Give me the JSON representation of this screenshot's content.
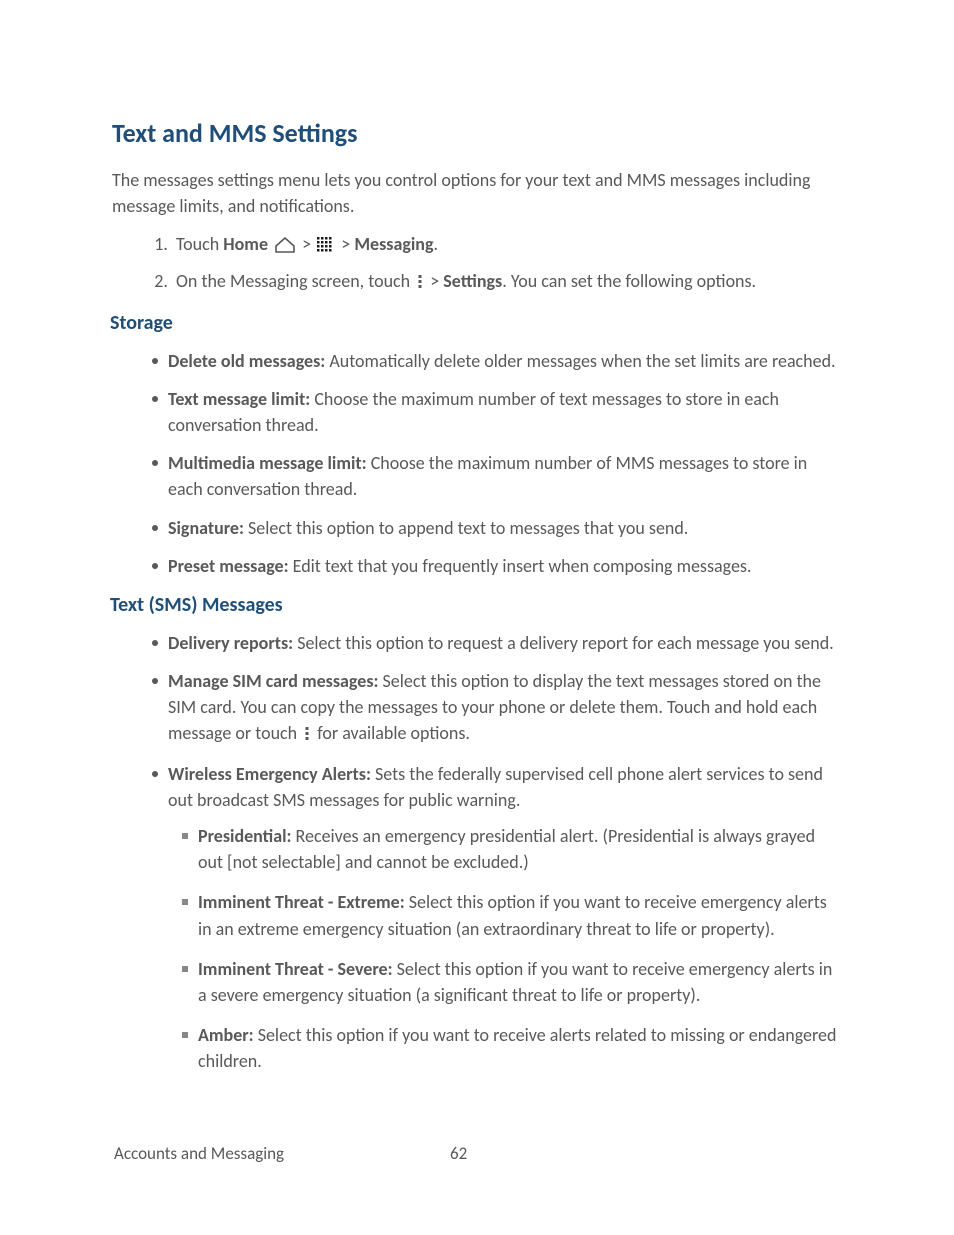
{
  "title": "Text and MMS Settings",
  "intro": "The messages settings menu lets you control options for your text and MMS messages including message limits, and notifications.",
  "steps": {
    "s1_prefix": "Touch ",
    "s1_home": "Home",
    "s1_sep1": " > ",
    "s1_sep2": " > ",
    "s1_messaging": "Messaging",
    "s1_end": ".",
    "s2_prefix": "On the Messaging screen, touch ",
    "s2_sep": " > ",
    "s2_settings": "Settings",
    "s2_end": ". You can set the following options."
  },
  "storage": {
    "heading": "Storage",
    "items": [
      {
        "label": "Delete old messages:",
        "text": " Automatically delete older messages when the set limits are reached."
      },
      {
        "label": "Text message limit:",
        "text": " Choose the maximum number of text messages to store in each conversation thread."
      },
      {
        "label": "Multimedia message limit:",
        "text": " Choose the maximum number of MMS messages to store in each conversation thread."
      },
      {
        "label": "Signature:",
        "text": " Select this option to append text to messages that you send."
      },
      {
        "label": "Preset message:",
        "text": " Edit text that you frequently insert when composing messages."
      }
    ]
  },
  "sms": {
    "heading": "Text (SMS) Messages",
    "delivery": {
      "label": "Delivery reports:",
      "text": " Select this option to request a delivery report for each message you send."
    },
    "sim": {
      "label": "Manage SIM card messages:",
      "text_a": " Select this option to display the text messages stored on the SIM card. You can copy the messages to your phone or delete them. Touch and hold each message or touch ",
      "text_b": " for available options."
    },
    "wea": {
      "label": "Wireless Emergency Alerts:",
      "text": " Sets the federally supervised cell phone alert services to send out broadcast SMS messages for public warning.",
      "items": [
        {
          "label": "Presidential:",
          "text": " Receives an emergency presidential alert. (Presidential is always grayed out [not selectable] and cannot be excluded.)"
        },
        {
          "label": "Imminent Threat - Extreme:",
          "text": " Select this option if you want to receive emergency alerts in an extreme emergency situation (an extraordinary threat to life or property)."
        },
        {
          "label": "Imminent Threat - Severe:",
          "text": " Select this option if you want to receive emergency alerts in a severe emergency situation (a significant threat to life or property)."
        },
        {
          "label": "Amber:",
          "text": " Select this option if you want to receive alerts related to missing or endangered children."
        }
      ]
    }
  },
  "footer": {
    "section": "Accounts and Messaging",
    "page": "62"
  }
}
